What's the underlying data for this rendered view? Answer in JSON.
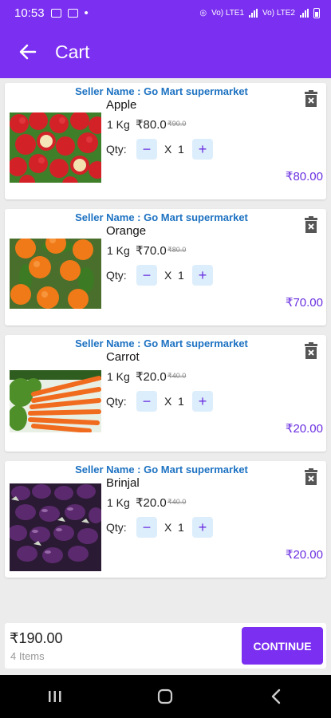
{
  "status_bar": {
    "time": "10:53",
    "network_text_1": "Vo) LTE1",
    "network_text_2": "Vo) LTE2"
  },
  "header": {
    "title": "Cart",
    "back_icon": "arrow-left-icon"
  },
  "cart_items": [
    {
      "seller": "Seller Name : Go Mart supermarket",
      "name": "Apple",
      "weight": "1 Kg",
      "price": "₹80.0",
      "mrp": "₹90.0",
      "qty_label": "Qty:",
      "qty_sep": "X",
      "qty": "1",
      "line_total": "₹80.00"
    },
    {
      "seller": "Seller Name : Go Mart supermarket",
      "name": "Orange",
      "weight": "1 Kg",
      "price": "₹70.0",
      "mrp": "₹80.0",
      "qty_label": "Qty:",
      "qty_sep": "X",
      "qty": "1",
      "line_total": "₹70.00"
    },
    {
      "seller": "Seller Name : Go Mart supermarket",
      "name": "Carrot",
      "weight": "1 Kg",
      "price": "₹20.0",
      "mrp": "₹40.0",
      "qty_label": "Qty:",
      "qty_sep": "X",
      "qty": "1",
      "line_total": "₹20.00"
    },
    {
      "seller": "Seller Name : Go Mart supermarket",
      "name": "Brinjal",
      "weight": "1 Kg",
      "price": "₹20.0",
      "mrp": "₹40.0",
      "qty_label": "Qty:",
      "qty_sep": "X",
      "qty": "1",
      "line_total": "₹20.00"
    }
  ],
  "summary": {
    "total": "₹190.00",
    "items_count": "4 Items",
    "continue_label": "CONTINUE"
  },
  "colors": {
    "primary": "#7b2ff0",
    "seller_text": "#1d72c2",
    "qty_button_bg": "#dcedfb"
  }
}
